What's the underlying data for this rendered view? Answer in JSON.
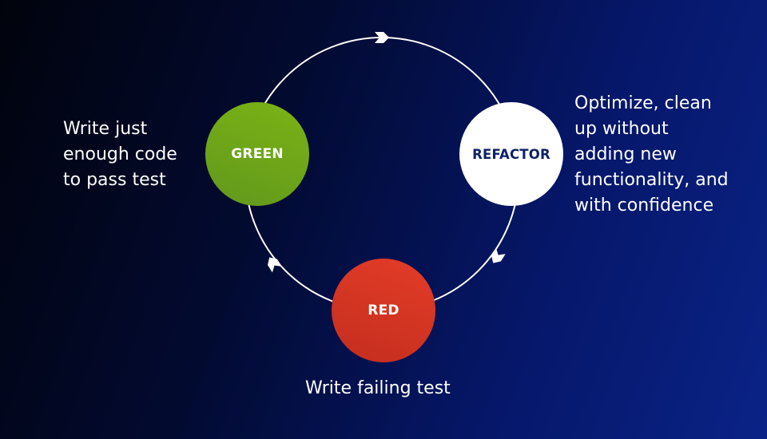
{
  "diagram": {
    "title_hidden": "",
    "cycle_direction": "clockwise",
    "nodes": {
      "green": {
        "label": "GREEN",
        "color": "#6fa81a",
        "text_color": "#ffffff"
      },
      "refactor": {
        "label": "REFACTOR",
        "color": "#ffffff",
        "text_color": "#0d2266"
      },
      "red": {
        "label": "RED",
        "color": "#d83a25",
        "text_color": "#ffffff"
      }
    },
    "descriptions": {
      "green": "Write just\nenough code\nto pass test",
      "refactor": "Optimize, clean\nup without\nadding new\nfunctionality, and\nwith confidence",
      "red": "Write failing test"
    },
    "ring_color": "#ffffff",
    "background": {
      "from": "#01030c",
      "to": "#0a2386"
    }
  }
}
